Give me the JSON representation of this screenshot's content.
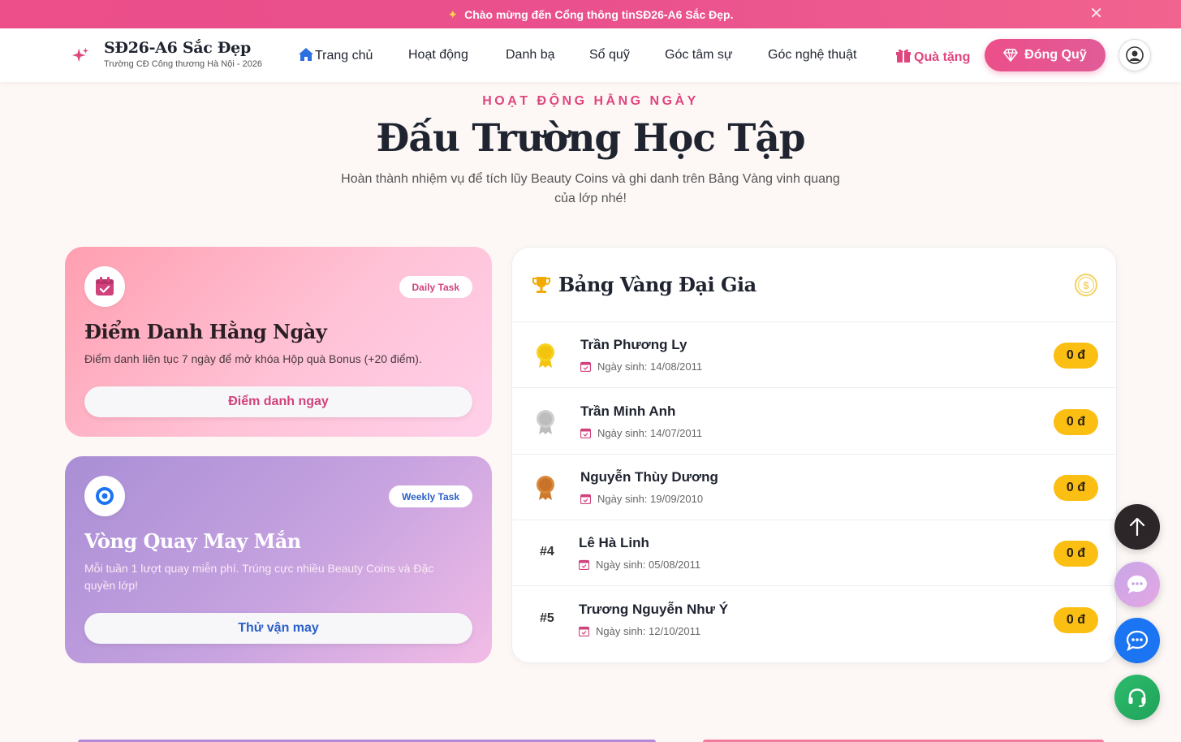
{
  "announcement": {
    "prefix": "Chào mừng đến Cổng thông tin ",
    "highlight": "SĐ26-A6 Sắc Đẹp",
    "suffix": ".",
    "close": "✕"
  },
  "brand": {
    "title": "SĐ26-A6 Sắc Đẹp",
    "subtitle": "Trường CĐ Công thương Hà Nội - 2026"
  },
  "nav": {
    "home": "Trang chủ",
    "activities": "Hoạt động",
    "contacts": "Danh bạ",
    "fund_book": "Sổ quỹ",
    "confide": "Góc tâm sự",
    "art": "Góc nghệ thuật",
    "gifts": "Quà tặng",
    "pay_fund": "Đóng Quỹ"
  },
  "hero": {
    "eyebrow": "HOẠT ĐỘNG HẰNG NGÀY",
    "title": "Đấu Trường Học Tập",
    "description": "Hoàn thành nhiệm vụ để tích lũy Beauty Coins và ghi danh trên Bảng Vàng vinh quang của lớp nhé!"
  },
  "daily": {
    "badge": "Daily Task",
    "title": "Điểm Danh Hằng Ngày",
    "description": "Điểm danh liên tục 7 ngày để mở khóa Hộp quà Bonus (+20 điểm).",
    "button": "Điểm danh ngay"
  },
  "weekly": {
    "badge": "Weekly Task",
    "title": "Vòng Quay May Mắn",
    "description": "Mỗi tuần 1 lượt quay miễn phí. Trúng cực nhiều Beauty Coins và Đặc quyền lớp!",
    "button": "Thử vận may"
  },
  "leaderboard": {
    "title": "Bảng Vàng Đại Gia",
    "birth_label": "Ngày sinh: ",
    "rows": [
      {
        "name": "Trần Phương Ly",
        "birth": "Ngày sinh: 14/08/2011",
        "amount": "0 đ",
        "medal": "gold"
      },
      {
        "name": "Trần Minh Anh",
        "birth": "Ngày sinh: 14/07/2011",
        "amount": "0 đ",
        "medal": "silver"
      },
      {
        "name": "Nguyễn Thùy Dương",
        "birth": "Ngày sinh: 19/09/2010",
        "amount": "0 đ",
        "medal": "bronze"
      },
      {
        "name": "Lê Hà Linh",
        "birth": "Ngày sinh: 05/08/2011",
        "amount": "0 đ",
        "rank": "#4"
      },
      {
        "name": "Trương Nguyễn Như Ý",
        "birth": "Ngày sinh: 12/10/2011",
        "amount": "0 đ",
        "rank": "#5"
      }
    ]
  },
  "colors": {
    "brand_pink": "#e0457e",
    "gold": "#fbbf14",
    "weekly_blue": "#2b5fc9",
    "messenger_blue": "#1b74f2",
    "support_green": "#2dbb6d"
  },
  "icons": {
    "announce": "sparkle-icon",
    "brand": "sparkle-icon",
    "home": "home-icon",
    "gift": "gift-icon",
    "diamond": "diamond-icon",
    "user": "user-circle-icon",
    "daily": "calendar-check-icon",
    "weekly": "target-icon",
    "trophy": "trophy-icon",
    "coin": "dollar-coin-icon",
    "scroll_top": "arrow-up-icon",
    "chat": "chat-bubble-icon",
    "messenger": "messenger-icon",
    "support": "headset-icon"
  }
}
